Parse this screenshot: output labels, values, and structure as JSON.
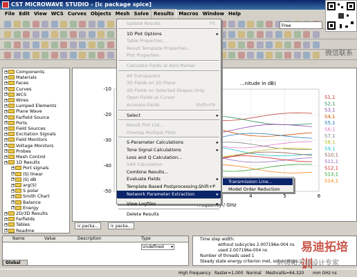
{
  "window": {
    "title": "CST MICROWAVE STUDIO - [ic package spice]"
  },
  "menubar": [
    "File",
    "Edit",
    "View",
    "WCS",
    "Curves",
    "Objects",
    "Mesh",
    "Solve",
    "Results",
    "Macros",
    "Window",
    "Help"
  ],
  "toolbar": {
    "free_label": "Free"
  },
  "results_menu": {
    "items": [
      {
        "label": "Update Results",
        "shortcut": "F5",
        "disabled": true
      },
      {
        "sep": true
      },
      {
        "label": "1D Plot Options",
        "arrow": true
      },
      {
        "label": "Table Properties...",
        "disabled": true
      },
      {
        "label": "Result Template Properties...",
        "disabled": true
      },
      {
        "label": "Plot Properties",
        "disabled": true
      },
      {
        "sep": true
      },
      {
        "label": "Calculate Fields at Axis Marker",
        "disabled": true
      },
      {
        "sep": true
      },
      {
        "label": "All Transparent",
        "disabled": true
      },
      {
        "label": "3D Fields on 2D Plane",
        "disabled": true
      },
      {
        "label": "2D Fields on Selected Shapes Only",
        "disabled": true
      },
      {
        "label": "Open Fields at Cursor",
        "disabled": true
      },
      {
        "label": "Animate Fields",
        "shortcut": "Shift+F9",
        "disabled": true
      },
      {
        "sep": true
      },
      {
        "label": "Select",
        "arrow": true
      },
      {
        "sep": true
      },
      {
        "label": "Result Plot List...",
        "disabled": true
      },
      {
        "label": "Overlap Multiple Plots",
        "disabled": true
      },
      {
        "sep": true
      },
      {
        "label": "S-Parameter Calculations",
        "arrow": true
      },
      {
        "label": "Tone Signal Calculations",
        "arrow": true
      },
      {
        "label": "Loss and Q Calculation..."
      },
      {
        "label": "SAR Calculation",
        "disabled": true
      },
      {
        "label": "Combine Results..."
      },
      {
        "label": "Evaluate Fields",
        "arrow": true
      },
      {
        "label": "Template Based Postprocessing...",
        "shortcut": "Shift+P"
      },
      {
        "label": "Network Parameter Extraction",
        "arrow": true,
        "highlight": true
      },
      {
        "sep": true
      },
      {
        "label": "View Logfiles",
        "arrow": true
      },
      {
        "sep": true
      },
      {
        "label": "Delete Results"
      }
    ],
    "submenu": [
      {
        "label": "Transmission Line...",
        "highlight": true
      },
      {
        "label": "Model Order Reduction"
      }
    ]
  },
  "tree": {
    "items": [
      {
        "label": "Components",
        "level": 0
      },
      {
        "label": "Materials",
        "level": 0
      },
      {
        "label": "Faces",
        "level": 0
      },
      {
        "label": "Curves",
        "level": 0
      },
      {
        "label": "WCS",
        "level": 0
      },
      {
        "label": "Wires",
        "level": 0
      },
      {
        "label": "Lumped Elements",
        "level": 0
      },
      {
        "label": "Plane Wave",
        "level": 0
      },
      {
        "label": "Farfield Source",
        "level": 0
      },
      {
        "label": "Ports",
        "level": 0
      },
      {
        "label": "Field Sources",
        "level": 0
      },
      {
        "label": "Excitation Signals",
        "level": 0
      },
      {
        "label": "Field Monitors",
        "level": 0
      },
      {
        "label": "Voltage Monitors",
        "level": 0
      },
      {
        "label": "Probes",
        "level": 0
      },
      {
        "label": "Mesh Control",
        "level": 0
      },
      {
        "label": "1D Results",
        "level": 0
      },
      {
        "label": "Port signals",
        "level": 1
      },
      {
        "label": "|S| linear",
        "level": 1
      },
      {
        "label": "|S| dB",
        "level": 1
      },
      {
        "label": "arg(S)",
        "level": 1
      },
      {
        "label": "S polar",
        "level": 1
      },
      {
        "label": "Smith Chart",
        "level": 1
      },
      {
        "label": "Balance",
        "level": 1
      },
      {
        "label": "Energy",
        "level": 1
      },
      {
        "label": "2D/3D Results",
        "level": 0
      },
      {
        "label": "Farfields",
        "level": 0
      },
      {
        "label": "Tables",
        "level": 0
      },
      {
        "label": "Readme",
        "level": 0
      }
    ]
  },
  "chart_data": {
    "type": "line",
    "title": "...nitude in dB)",
    "xlabel": "Frequency / GHz",
    "ylabel": "",
    "xlim": [
      0,
      6
    ],
    "ylim": [
      -50,
      -10
    ],
    "xticks": [
      "4",
      "5",
      "6"
    ],
    "yticks": [
      "-10",
      "-20",
      "-30",
      "-40",
      "-50"
    ],
    "legend": [
      "S1,1",
      "S2,1",
      "S3,1",
      "S4,1",
      "S5,1",
      "S6,1",
      "S7,1",
      "S8,1",
      "S9,1",
      "S10,1",
      "S11,1",
      "S12,1",
      "S13,1",
      "S14,1"
    ],
    "colors": [
      "#c0392b",
      "#2e8b57",
      "#8e44ad",
      "#d35400",
      "#1f77b4",
      "#e377c2",
      "#7f7f7f",
      "#bcbd22",
      "#17becf",
      "#8c564b",
      "#9467bd",
      "#d62728",
      "#2ca02c",
      "#ff7f0e"
    ],
    "series_end": [
      -20,
      -23,
      -25,
      -27,
      -29,
      -31,
      -33,
      -34,
      -35,
      -36,
      -37,
      -38,
      -40,
      -42
    ]
  },
  "doc_tabs": [
    "ic packa...",
    "ic packa..."
  ],
  "param_table": {
    "headers": [
      "Name",
      "Value",
      "Description",
      "Type"
    ],
    "type_value": "Undefined",
    "tab": "Global"
  },
  "messages": [
    "Time step width:",
    "without subcycles  2.007196e-004 ns",
    "used  2.007196e-004 ns",
    "Number of threads used  1",
    "Steady state energy criterion met, solver stops."
  ],
  "status": {
    "left": "High Frequency",
    "raster": "Raster=1.000",
    "normal": "Normal",
    "meshcells": "Meshcells=64,320",
    "units": "mm  GHz  ns"
  },
  "watermark": {
    "line1": "易迪拓培训",
    "line2": "射频和天线设计专家",
    "qr_caption": "微信联系"
  }
}
